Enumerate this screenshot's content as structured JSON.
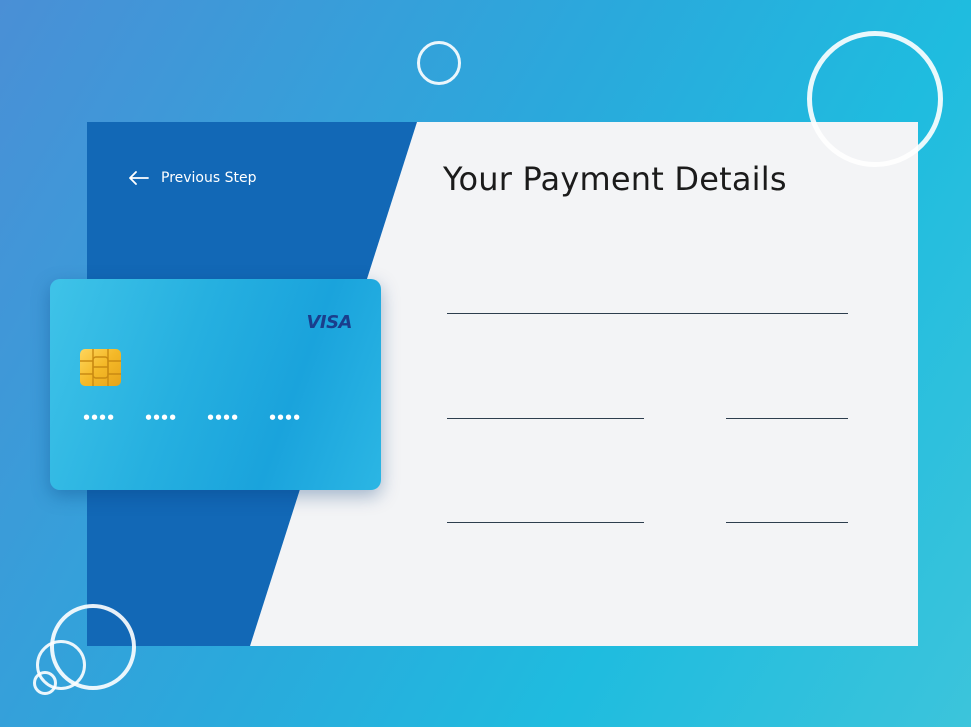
{
  "navigation": {
    "previous_step_label": "Previous Step",
    "previous_step_icon": "arrow-left-icon"
  },
  "form": {
    "title": "Your Payment Details",
    "fields": [
      {
        "value": "",
        "placeholder": ""
      },
      {
        "value": "",
        "placeholder": ""
      },
      {
        "value": "",
        "placeholder": ""
      },
      {
        "value": "",
        "placeholder": ""
      },
      {
        "value": "",
        "placeholder": ""
      }
    ]
  },
  "card": {
    "brand": "VISA",
    "number_groups": [
      "••••",
      "••••",
      "••••",
      "••••"
    ]
  },
  "colors": {
    "panel_blue": "#1268b6",
    "card_gradient_start": "#3fc3e8",
    "card_gradient_end": "#1aa3dc",
    "brand_text": "#1a3e8c",
    "chip": "#f4b928",
    "background_start": "#4a8fd6",
    "background_end": "#3cc4db"
  }
}
